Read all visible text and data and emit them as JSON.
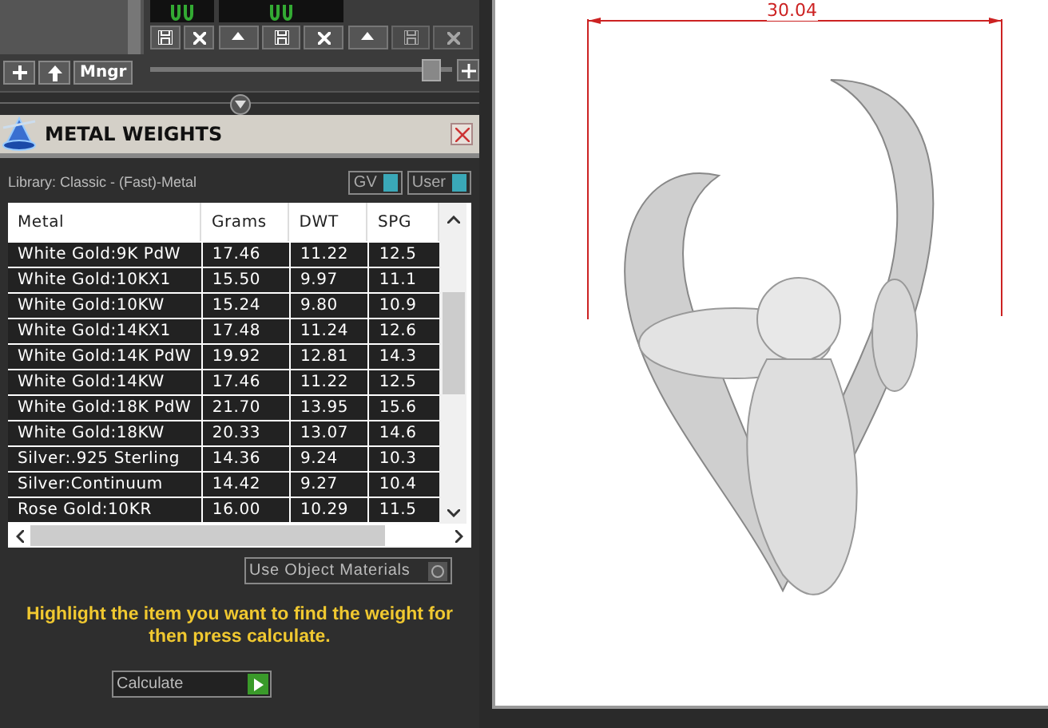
{
  "top_toolbar": {
    "manager_button": "Mngr",
    "thumbnails": [
      {
        "kind": "partial"
      },
      {
        "kind": "full"
      },
      {
        "kind": "empty"
      }
    ],
    "zoom_slider": {
      "level": 0.95
    }
  },
  "panel": {
    "title": "METAL WEIGHTS",
    "library": "Library: Classic - (Fast)-Metal",
    "toggles": [
      {
        "label": "GV",
        "on": true
      },
      {
        "label": "User",
        "on": true
      }
    ],
    "table": {
      "columns": [
        "Metal",
        "Grams",
        "DWT",
        "SPG"
      ],
      "rows": [
        [
          "White Gold:9K PdW",
          "17.46",
          "11.22",
          "12.5"
        ],
        [
          "White Gold:10KX1",
          "15.50",
          "9.97",
          "11.1"
        ],
        [
          "White Gold:10KW",
          "15.24",
          "9.80",
          "10.9"
        ],
        [
          "White Gold:14KX1",
          "17.48",
          "11.24",
          "12.6"
        ],
        [
          "White Gold:14K PdW",
          "19.92",
          "12.81",
          "14.3"
        ],
        [
          "White Gold:14KW",
          "17.46",
          "11.22",
          "12.5"
        ],
        [
          "White Gold:18K PdW",
          "21.70",
          "13.95",
          "15.6"
        ],
        [
          "White Gold:18KW",
          "20.33",
          "13.07",
          "14.6"
        ],
        [
          "Silver:.925 Sterling",
          "14.36",
          "9.24",
          "10.3"
        ],
        [
          "Silver:Continuum",
          "14.42",
          "9.27",
          "10.4"
        ],
        [
          "Rose Gold:10KR",
          "16.00",
          "10.29",
          "11.5"
        ]
      ]
    },
    "use_object_materials": {
      "label": "Use Object Materials",
      "checked": false
    },
    "hint": "Highlight the item you want to find the weight for then press calculate.",
    "calculate": "Calculate"
  },
  "viewport": {
    "dimension": "30.04"
  }
}
